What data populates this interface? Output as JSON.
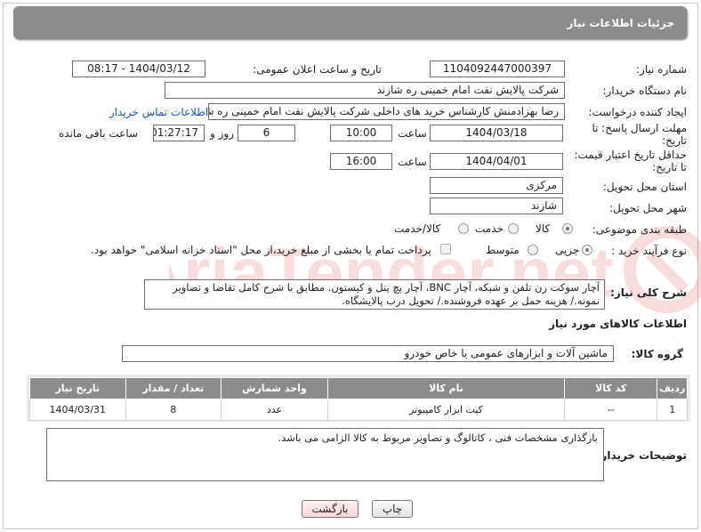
{
  "header": {
    "title": "جزئیات اطلاعات نیاز"
  },
  "fields": {
    "need_number_label": "شماره نیاز:",
    "need_number": "1104092447000397",
    "announce_label": "تاریخ و ساعت اعلان عمومی:",
    "announce_value": "1404/03/12 - 08:17",
    "buyer_org_label": "نام دستگاه خریدار:",
    "buyer_org": "شرکت پالایش نفت امام خمینی  ره  شازند",
    "requester_label": "ایجاد کننده درخواست:",
    "requester": "رضا بهزادمنش کارشناس خرید های داخلی  شرکت پالایش نفت امام خمینی  ره  شازند",
    "contact_link": "اطلاعات تماس خریدار",
    "deadline_label_1": "مهلت ارسال پاسخ: تا",
    "deadline_label_2": "تاریخ:",
    "deadline_date": "1404/03/18",
    "time_label": "ساعت",
    "deadline_time": "10:00",
    "days_value": "6",
    "days_label": "روز و",
    "remaining_value": "01:27:17",
    "remaining_label": "ساعت باقی مانده",
    "validity_label_1": "حداقل تاریخ اعتبار قیمت:",
    "validity_label_2": "تا تاریخ:",
    "validity_date": "1404/04/01",
    "validity_time": "16:00",
    "province_label": "استان محل تحویل:",
    "province": "مرکزی",
    "city_label": "شهر محل تحویل:",
    "city": "شازند",
    "category_label": "طبقه بندی موضوعی:",
    "category_options": [
      "کالا",
      "خدمت",
      "کالا/خدمت"
    ],
    "process_label": "نوع فرآیند خرید :",
    "process_options": [
      "جزیی",
      "متوسط"
    ],
    "payment_note": "پرداخت تمام یا بخشی از مبلغ خرید،از محل \"اسناد خزانه اسلامی\" خواهد بود.",
    "desc_label": "شرح کلی نیاز:",
    "description": "آچار سوکت زن تلفن و شبکه، آچار BNC، آچار پچ پنل و کیستون. مطابق با شرح کامل تقاضا و تصاویر نمونه./ هزینه حمل بر عهده فروشنده./ تحویل درب پالایشگاه."
  },
  "goods": {
    "section_title": "اطلاعات کالاهای مورد نیاز",
    "group_label": "گروه کالا:",
    "group_value": "ماشین آلات و ابزارهای عمومی یا خاص خودرو",
    "columns": [
      "ردیف",
      "کد کالا",
      "نام کالا",
      "واحد شمارش",
      "تعداد / مقدار",
      "تاریخ نیاز"
    ],
    "rows": [
      [
        "1",
        "--",
        "کیت ابزار کامپیوتر",
        "عدد",
        "8",
        "1404/03/31"
      ]
    ]
  },
  "buyer_notes": {
    "label": "توضیحات خریدار:",
    "text": "بارگذاری مشخصات فنی ، کاتالوگ و تصاویر مربوط به کالا الزامی می باشد."
  },
  "buttons": {
    "print": "چاپ",
    "back": "بازگشت"
  },
  "watermark_text": "AriaTender.net",
  "colors": {
    "header_bg": "#8c8c8c",
    "link": "#1a55b3",
    "back_button_bg": "#fde3e3"
  }
}
